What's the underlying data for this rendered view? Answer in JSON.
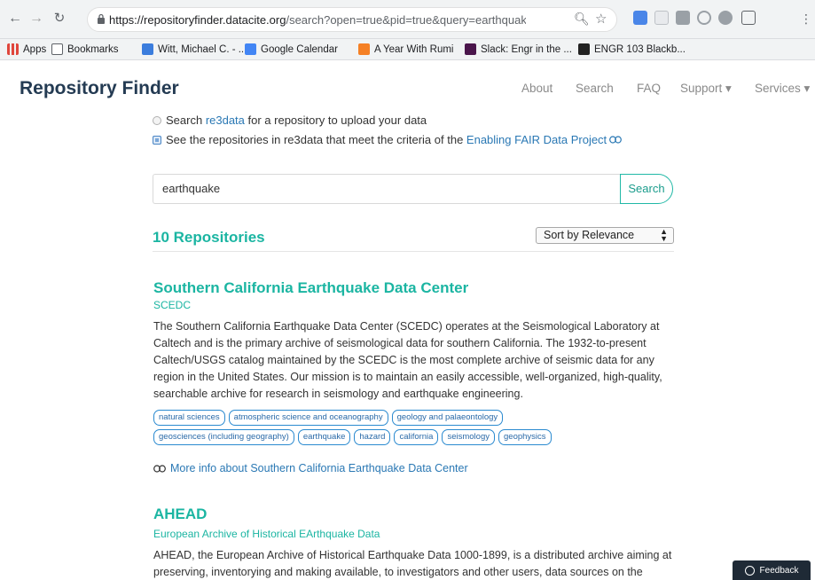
{
  "browser": {
    "url_host": "https://repositoryfinder.datacite.org",
    "url_path": "/search?open=true&pid=true&query=earthquake&sort...",
    "bookmarks": [
      {
        "label": "Apps",
        "color": "#e0463c"
      },
      {
        "label": "Bookmarks",
        "color": "#8a8a8a"
      },
      {
        "label": "Witt, Michael C. - ...",
        "color": "#3b7ddd"
      },
      {
        "label": "Google Calendar",
        "color": "#4285f4"
      },
      {
        "label": "A Year With Rumi",
        "color": "#f58025"
      },
      {
        "label": "Slack: Engr in the ...",
        "color": "#4a154b"
      },
      {
        "label": "ENGR 103 Blackb...",
        "color": "#222222"
      }
    ]
  },
  "site": {
    "brand": "Repository Finder",
    "nav": {
      "about": "About",
      "search": "Search",
      "faq": "FAQ",
      "support": "Support ▾",
      "services": "Services ▾"
    }
  },
  "options": {
    "option1_prefix": "Search ",
    "option1_link": "re3data",
    "option1_suffix": " for a repository to upload your data",
    "option2_text": "See the repositories in re3data that meet the criteria of the ",
    "option2_link": "Enabling FAIR Data Project"
  },
  "search": {
    "query": "earthquake",
    "button": "Search"
  },
  "results": {
    "count_label": "10 Repositories",
    "sort_label": "Sort by Relevance",
    "items": [
      {
        "title": "Southern California Earthquake Data Center",
        "subtitle": "SCEDC",
        "description": "The Southern California Earthquake Data Center (SCEDC) operates at the Seismological Laboratory at Caltech and is the primary archive of seismological data for southern California. The 1932-to-present Caltech/USGS catalog maintained by the SCEDC is the most complete archive of seismic data for any region in the United States. Our mission is to maintain an easily accessible, well-organized, high-quality, searchable archive for research in seismology and earthquake engineering.",
        "tags_row1": [
          "natural sciences",
          "atmospheric science and oceanography",
          "geology and palaeontology"
        ],
        "tags_row2": [
          "geosciences (including geography)",
          "earthquake",
          "hazard",
          "california",
          "seismology",
          "geophysics"
        ],
        "more_info": "More info about Southern California Earthquake Data Center"
      },
      {
        "title": "AHEAD",
        "subtitle": "European Archive of Historical EArthquake Data",
        "description": "AHEAD, the European Archive of Historical Earthquake Data 1000-1899, is a distributed archive aiming at preserving, inventorying and making available, to investigators and other users, data sources on the"
      }
    ]
  },
  "feedback": {
    "label": "Feedback"
  }
}
